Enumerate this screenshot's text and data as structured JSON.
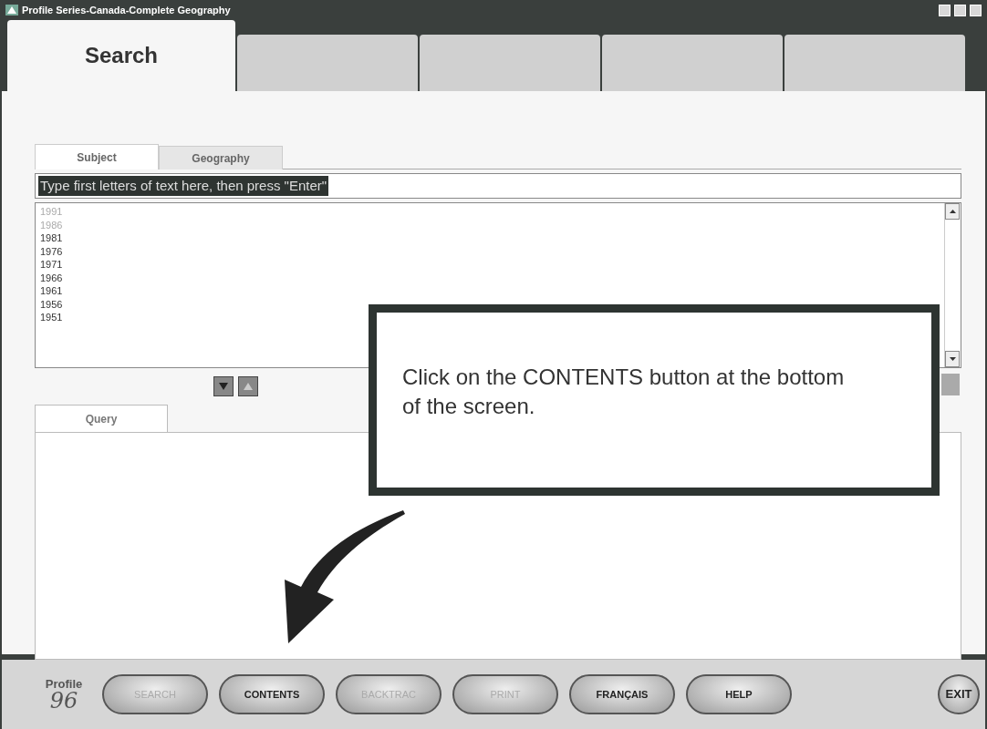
{
  "window": {
    "title": "Profile Series-Canada-Complete Geography"
  },
  "main_tabs": [
    {
      "label": "Search",
      "selected": true
    },
    {
      "selected": false
    },
    {
      "selected": false
    },
    {
      "selected": false
    },
    {
      "selected": false
    }
  ],
  "sub_tabs": [
    {
      "label": "Subject",
      "selected": true
    },
    {
      "label": "Geography",
      "selected": false
    }
  ],
  "search_field": {
    "value": "Type first letters of text here, then press \"Enter\""
  },
  "list_items": [
    {
      "text": "1991",
      "disabled": true
    },
    {
      "text": "1986",
      "disabled": true
    },
    {
      "text": "1981",
      "disabled": false
    },
    {
      "text": "1976",
      "disabled": false
    },
    {
      "text": "1971",
      "disabled": false
    },
    {
      "text": "1966",
      "disabled": false
    },
    {
      "text": "1961",
      "disabled": false
    },
    {
      "text": "1956",
      "disabled": false
    },
    {
      "text": "1951",
      "disabled": false
    }
  ],
  "query_tab": {
    "label": "Query",
    "selected": true
  },
  "callout": {
    "text": "Click on the CONTENTS button at the bottom of the screen."
  },
  "logo": {
    "word": "Profile",
    "number": "96"
  },
  "buttons": [
    {
      "label": "SEARCH",
      "disabled": true
    },
    {
      "label": "CONTENTS",
      "disabled": false
    },
    {
      "label": "BACKTRAC",
      "disabled": true
    },
    {
      "label": "PRINT",
      "disabled": true
    },
    {
      "label": "FRANÇAIS",
      "disabled": false
    },
    {
      "label": "HELP",
      "disabled": false
    },
    {
      "label": "EXIT",
      "disabled": false,
      "kind": "round"
    }
  ]
}
